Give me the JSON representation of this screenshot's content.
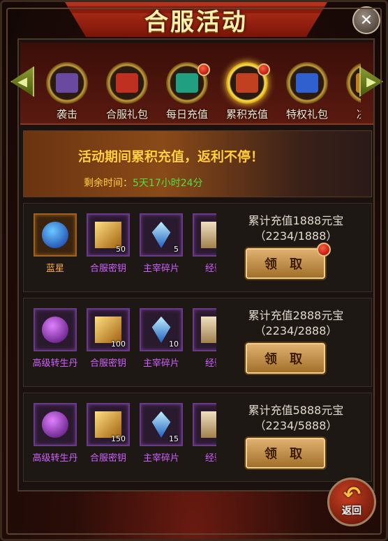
{
  "title": "合服活动",
  "close_icon_text": "✕",
  "tabs": [
    {
      "label": "袭击",
      "icon": "purple-gift-icon",
      "color": "#6a4aa0"
    },
    {
      "label": "合服礼包",
      "icon": "red-gift-box-icon",
      "color": "#c03020"
    },
    {
      "label": "每日充值",
      "icon": "treasure-ingot-icon",
      "color": "#20a080",
      "badge": true
    },
    {
      "label": "累积充值",
      "icon": "money-bag-icon",
      "color": "#c04020",
      "badge": true,
      "active": true
    },
    {
      "label": "特权礼包",
      "icon": "blue-gift-box-icon",
      "color": "#3060d0"
    },
    {
      "label": "决战",
      "icon": "gold-chest-icon",
      "color": "#c08020"
    }
  ],
  "banner": {
    "headline": "活动期间累积充值，返利不停！",
    "time_label": "剩余时间：",
    "time_value": "5天17小时24分"
  },
  "rewards": [
    {
      "requirement": "累计充值1888元宝",
      "progress": "（2234/1888）",
      "button": "领 取",
      "badge": true,
      "items": [
        {
          "name": "蓝星",
          "count": "",
          "rarity": "orange",
          "icon": "blue-star-gem-icon"
        },
        {
          "name": "合服密钥",
          "count": "50",
          "rarity": "purple",
          "icon": "golden-key-icon"
        },
        {
          "name": "主宰碎片",
          "count": "5",
          "rarity": "purple",
          "icon": "blue-crystal-shard-icon"
        },
        {
          "name": "经验",
          "count": "",
          "rarity": "purple",
          "icon": "scroll-icon"
        }
      ]
    },
    {
      "requirement": "累计充值2888元宝",
      "progress": "（2234/2888）",
      "button": "领 取",
      "badge": false,
      "items": [
        {
          "name": "高级转生丹",
          "count": "",
          "rarity": "purple",
          "icon": "purple-orb-icon"
        },
        {
          "name": "合服密钥",
          "count": "100",
          "rarity": "purple",
          "icon": "golden-key-icon"
        },
        {
          "name": "主宰碎片",
          "count": "10",
          "rarity": "purple",
          "icon": "blue-crystal-shard-icon"
        },
        {
          "name": "经验",
          "count": "",
          "rarity": "purple",
          "icon": "scroll-icon"
        }
      ]
    },
    {
      "requirement": "累计充值5888元宝",
      "progress": "（2234/5888）",
      "button": "领 取",
      "badge": false,
      "items": [
        {
          "name": "高级转生丹",
          "count": "",
          "rarity": "purple",
          "icon": "purple-orb-icon"
        },
        {
          "name": "合服密钥",
          "count": "150",
          "rarity": "purple",
          "icon": "golden-key-icon"
        },
        {
          "name": "主宰碎片",
          "count": "15",
          "rarity": "purple",
          "icon": "blue-crystal-shard-icon"
        },
        {
          "name": "经验",
          "count": "",
          "rarity": "purple",
          "icon": "scroll-icon"
        }
      ]
    }
  ],
  "back_label": "返回",
  "colors": {
    "gold": "#ffd040",
    "green": "#50e040",
    "purple_text": "#d060ff",
    "orange_text": "#ffb030"
  }
}
